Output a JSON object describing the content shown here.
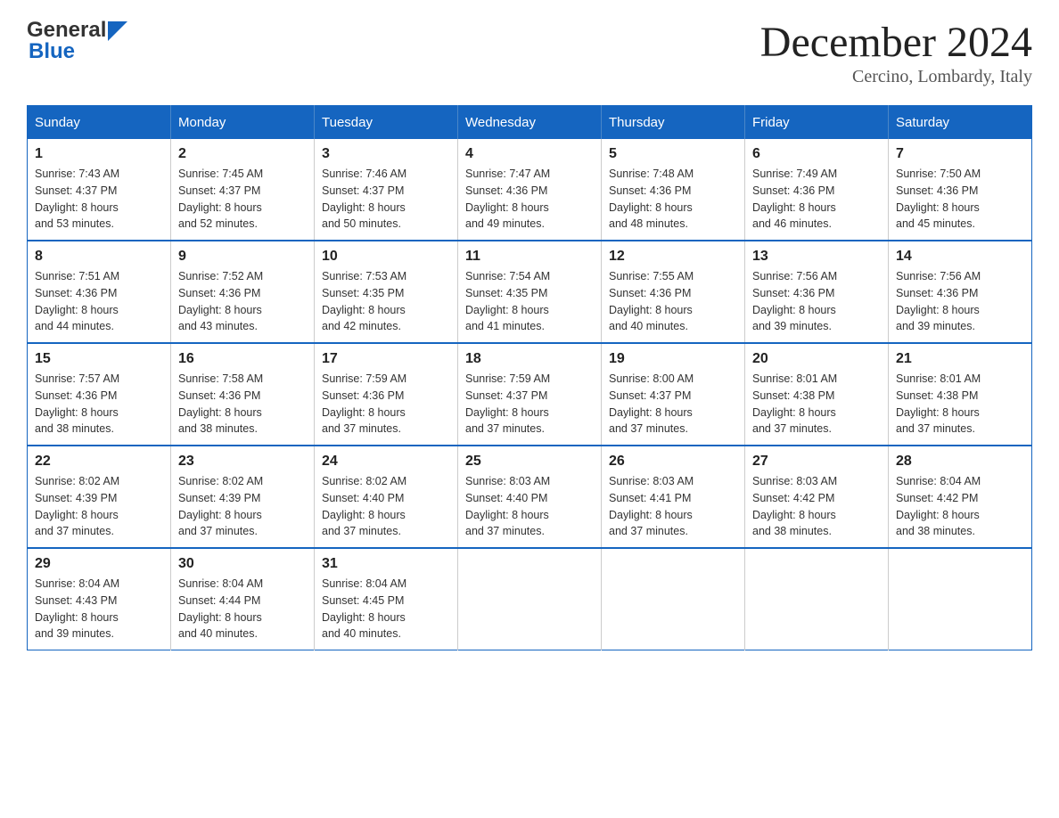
{
  "header": {
    "logo": {
      "general": "General",
      "blue": "Blue"
    },
    "title": "December 2024",
    "location": "Cercino, Lombardy, Italy"
  },
  "days_of_week": [
    "Sunday",
    "Monday",
    "Tuesday",
    "Wednesday",
    "Thursday",
    "Friday",
    "Saturday"
  ],
  "weeks": [
    [
      {
        "day": "1",
        "sunrise": "7:43 AM",
        "sunset": "4:37 PM",
        "daylight": "8 hours and 53 minutes."
      },
      {
        "day": "2",
        "sunrise": "7:45 AM",
        "sunset": "4:37 PM",
        "daylight": "8 hours and 52 minutes."
      },
      {
        "day": "3",
        "sunrise": "7:46 AM",
        "sunset": "4:37 PM",
        "daylight": "8 hours and 50 minutes."
      },
      {
        "day": "4",
        "sunrise": "7:47 AM",
        "sunset": "4:36 PM",
        "daylight": "8 hours and 49 minutes."
      },
      {
        "day": "5",
        "sunrise": "7:48 AM",
        "sunset": "4:36 PM",
        "daylight": "8 hours and 48 minutes."
      },
      {
        "day": "6",
        "sunrise": "7:49 AM",
        "sunset": "4:36 PM",
        "daylight": "8 hours and 46 minutes."
      },
      {
        "day": "7",
        "sunrise": "7:50 AM",
        "sunset": "4:36 PM",
        "daylight": "8 hours and 45 minutes."
      }
    ],
    [
      {
        "day": "8",
        "sunrise": "7:51 AM",
        "sunset": "4:36 PM",
        "daylight": "8 hours and 44 minutes."
      },
      {
        "day": "9",
        "sunrise": "7:52 AM",
        "sunset": "4:36 PM",
        "daylight": "8 hours and 43 minutes."
      },
      {
        "day": "10",
        "sunrise": "7:53 AM",
        "sunset": "4:35 PM",
        "daylight": "8 hours and 42 minutes."
      },
      {
        "day": "11",
        "sunrise": "7:54 AM",
        "sunset": "4:35 PM",
        "daylight": "8 hours and 41 minutes."
      },
      {
        "day": "12",
        "sunrise": "7:55 AM",
        "sunset": "4:36 PM",
        "daylight": "8 hours and 40 minutes."
      },
      {
        "day": "13",
        "sunrise": "7:56 AM",
        "sunset": "4:36 PM",
        "daylight": "8 hours and 39 minutes."
      },
      {
        "day": "14",
        "sunrise": "7:56 AM",
        "sunset": "4:36 PM",
        "daylight": "8 hours and 39 minutes."
      }
    ],
    [
      {
        "day": "15",
        "sunrise": "7:57 AM",
        "sunset": "4:36 PM",
        "daylight": "8 hours and 38 minutes."
      },
      {
        "day": "16",
        "sunrise": "7:58 AM",
        "sunset": "4:36 PM",
        "daylight": "8 hours and 38 minutes."
      },
      {
        "day": "17",
        "sunrise": "7:59 AM",
        "sunset": "4:36 PM",
        "daylight": "8 hours and 37 minutes."
      },
      {
        "day": "18",
        "sunrise": "7:59 AM",
        "sunset": "4:37 PM",
        "daylight": "8 hours and 37 minutes."
      },
      {
        "day": "19",
        "sunrise": "8:00 AM",
        "sunset": "4:37 PM",
        "daylight": "8 hours and 37 minutes."
      },
      {
        "day": "20",
        "sunrise": "8:01 AM",
        "sunset": "4:38 PM",
        "daylight": "8 hours and 37 minutes."
      },
      {
        "day": "21",
        "sunrise": "8:01 AM",
        "sunset": "4:38 PM",
        "daylight": "8 hours and 37 minutes."
      }
    ],
    [
      {
        "day": "22",
        "sunrise": "8:02 AM",
        "sunset": "4:39 PM",
        "daylight": "8 hours and 37 minutes."
      },
      {
        "day": "23",
        "sunrise": "8:02 AM",
        "sunset": "4:39 PM",
        "daylight": "8 hours and 37 minutes."
      },
      {
        "day": "24",
        "sunrise": "8:02 AM",
        "sunset": "4:40 PM",
        "daylight": "8 hours and 37 minutes."
      },
      {
        "day": "25",
        "sunrise": "8:03 AM",
        "sunset": "4:40 PM",
        "daylight": "8 hours and 37 minutes."
      },
      {
        "day": "26",
        "sunrise": "8:03 AM",
        "sunset": "4:41 PM",
        "daylight": "8 hours and 37 minutes."
      },
      {
        "day": "27",
        "sunrise": "8:03 AM",
        "sunset": "4:42 PM",
        "daylight": "8 hours and 38 minutes."
      },
      {
        "day": "28",
        "sunrise": "8:04 AM",
        "sunset": "4:42 PM",
        "daylight": "8 hours and 38 minutes."
      }
    ],
    [
      {
        "day": "29",
        "sunrise": "8:04 AM",
        "sunset": "4:43 PM",
        "daylight": "8 hours and 39 minutes."
      },
      {
        "day": "30",
        "sunrise": "8:04 AM",
        "sunset": "4:44 PM",
        "daylight": "8 hours and 40 minutes."
      },
      {
        "day": "31",
        "sunrise": "8:04 AM",
        "sunset": "4:45 PM",
        "daylight": "8 hours and 40 minutes."
      },
      null,
      null,
      null,
      null
    ]
  ],
  "labels": {
    "sunrise": "Sunrise:",
    "sunset": "Sunset:",
    "daylight": "Daylight:"
  }
}
